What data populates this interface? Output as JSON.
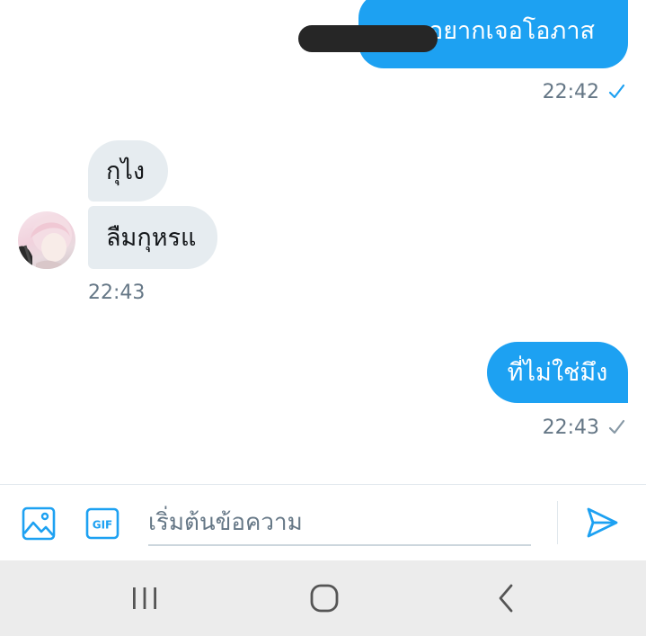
{
  "conversation": {
    "messages": [
      {
        "direction": "outgoing",
        "text": "อยากเจอโอภาส",
        "time": "22:42",
        "status": "read"
      },
      {
        "direction": "incoming",
        "text": "กุไง"
      },
      {
        "direction": "incoming",
        "text": "ลืมกุหรแ",
        "time": "22:43"
      },
      {
        "direction": "outgoing",
        "text": "ที่ไม่ใช่มึง",
        "time": "22:43",
        "status": "sent"
      }
    ]
  },
  "composer": {
    "placeholder": "เริ่มต้นข้อความ",
    "gif_label": "GIF",
    "icons": {
      "image": "image-icon",
      "gif": "gif-icon",
      "send": "send-icon"
    }
  },
  "navbar": {
    "icons": [
      "recents-icon",
      "home-icon",
      "back-icon"
    ]
  },
  "colors": {
    "accent": "#1da1f2",
    "incoming_bubble": "#e6ecf0",
    "timestamp": "#657786",
    "read_check": "#1da1f2",
    "sent_check": "#8899a6",
    "navbar_bg": "#ececec"
  }
}
